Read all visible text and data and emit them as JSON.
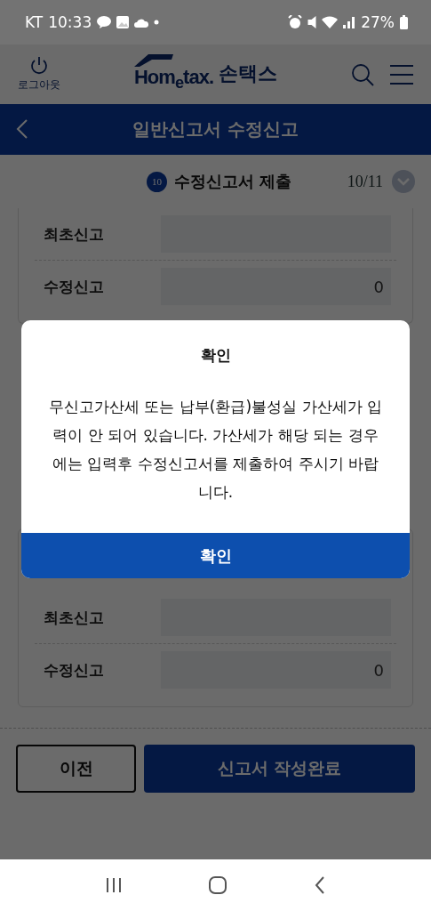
{
  "status_bar": {
    "carrier": "KT",
    "time": "10:33",
    "battery": "27%"
  },
  "header": {
    "logout_label": "로그아웃",
    "logo_text": "Hom$_{e}$tax.",
    "brand": "손택스"
  },
  "title_bar": {
    "title": "일반신고서 수정신고"
  },
  "step": {
    "number": "10",
    "title": "수정신고서 제출",
    "progress": "10/11"
  },
  "cards": [
    {
      "rows": [
        {
          "label": "최초신고"
        },
        {
          "label": "수정신고",
          "value": "0"
        }
      ]
    },
    {
      "rows": [
        {
          "label": "최초신고"
        },
        {
          "label": "수정신고",
          "value": "0"
        }
      ]
    }
  ],
  "footer": {
    "prev": "이전",
    "complete": "신고서 작성완료"
  },
  "dialog": {
    "title": "확인",
    "message": "무신고가산세 또는 납부(환급)불성실 가산세가 입력이 안 되어 있습니다. 가산세가 해당 되는 경우에는 입력후 수정신고서를 제출하여 주시기 바랍니다.",
    "confirm": "확인"
  }
}
